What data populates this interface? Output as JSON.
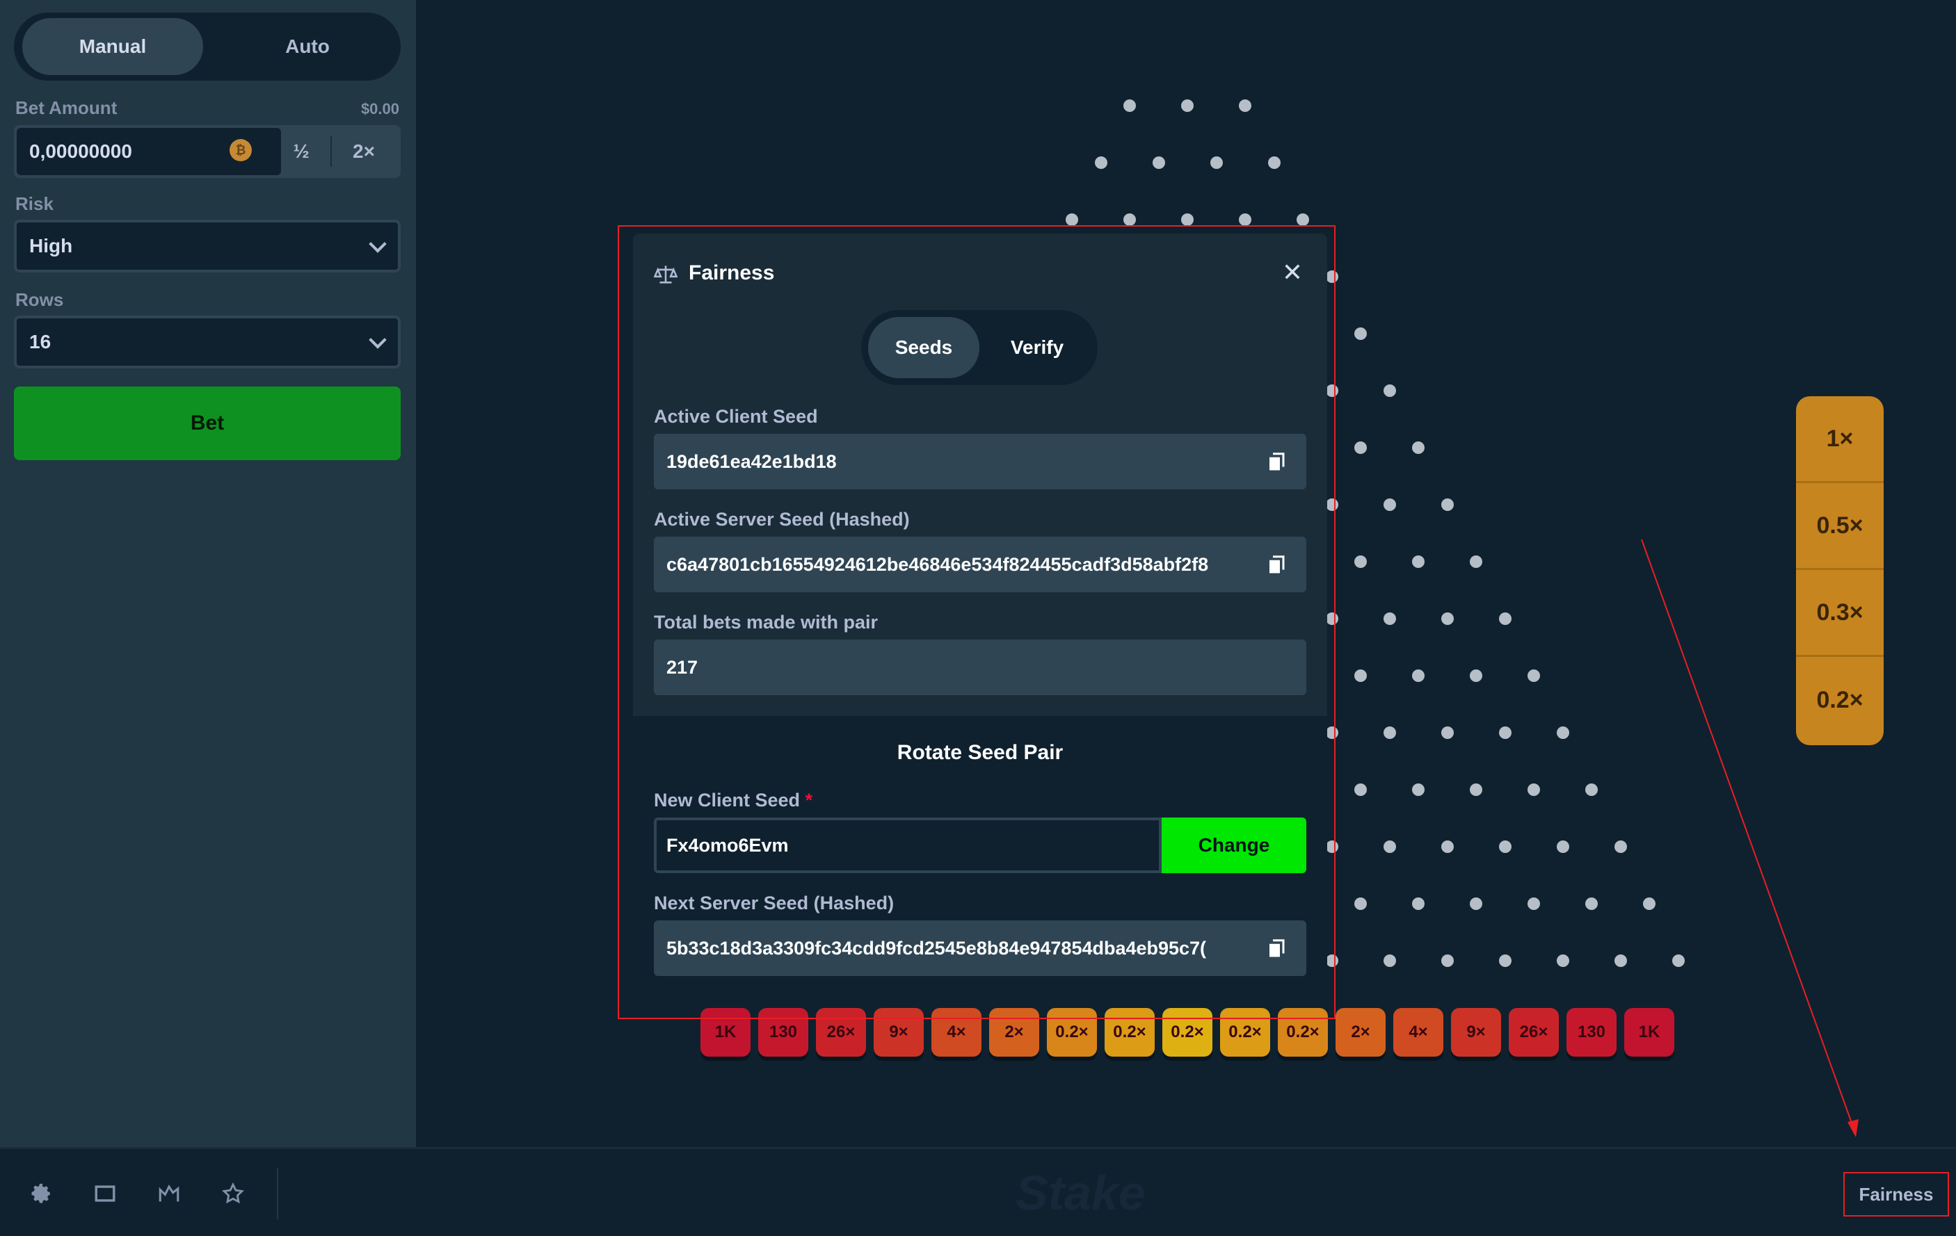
{
  "sidebar": {
    "mode_manual": "Manual",
    "mode_auto": "Auto",
    "bet_amount_label": "Bet Amount",
    "bet_amount_usd": "$0.00",
    "bet_amount_value": "0,00000000",
    "half_label": "½",
    "double_label": "2×",
    "risk_label": "Risk",
    "risk_value": "High",
    "rows_label": "Rows",
    "rows_value": "16",
    "bet_button": "Bet"
  },
  "modal": {
    "title": "Fairness",
    "tab_seeds": "Seeds",
    "tab_verify": "Verify",
    "active_client_seed_label": "Active Client Seed",
    "active_client_seed": "19de61ea42e1bd18",
    "active_server_seed_label": "Active Server Seed (Hashed)",
    "active_server_seed": "c6a47801cb16554924612be46846e534f824455cadf3d58abf2f8",
    "total_bets_label": "Total bets made with pair",
    "total_bets": "217",
    "rotate_title": "Rotate Seed Pair",
    "new_client_seed_label": "New Client Seed",
    "required_mark": "*",
    "new_client_seed": "Fx4omo6Evm",
    "change_button": "Change",
    "next_server_seed_label": "Next Server Seed (Hashed)",
    "next_server_seed": "5b33c18d3a3309fc34cdd9fcd2545e8b84e947854dba4eb95c7("
  },
  "buckets": [
    {
      "label": "1K",
      "color": "#c2132f"
    },
    {
      "label": "130",
      "color": "#c6182c"
    },
    {
      "label": "26×",
      "color": "#c92329"
    },
    {
      "label": "9×",
      "color": "#cc3326"
    },
    {
      "label": "4×",
      "color": "#d04a22"
    },
    {
      "label": "2×",
      "color": "#d4621e"
    },
    {
      "label": "0.2×",
      "color": "#d8861a"
    },
    {
      "label": "0.2×",
      "color": "#dc9c16"
    },
    {
      "label": "0.2×",
      "color": "#dfb012"
    },
    {
      "label": "0.2×",
      "color": "#dc9c16"
    },
    {
      "label": "0.2×",
      "color": "#d8861a"
    },
    {
      "label": "2×",
      "color": "#d4621e"
    },
    {
      "label": "4×",
      "color": "#d04a22"
    },
    {
      "label": "9×",
      "color": "#cc3326"
    },
    {
      "label": "26×",
      "color": "#c92329"
    },
    {
      "label": "130",
      "color": "#c6182c"
    },
    {
      "label": "1K",
      "color": "#c2132f"
    }
  ],
  "history": [
    "1×",
    "0.5×",
    "0.3×",
    "0.2×"
  ],
  "bottom": {
    "logo": "Stake",
    "fairness_link": "Fairness",
    "icons": [
      "settings-icon",
      "theatre-mode-icon",
      "stats-icon",
      "favorite-icon"
    ]
  }
}
